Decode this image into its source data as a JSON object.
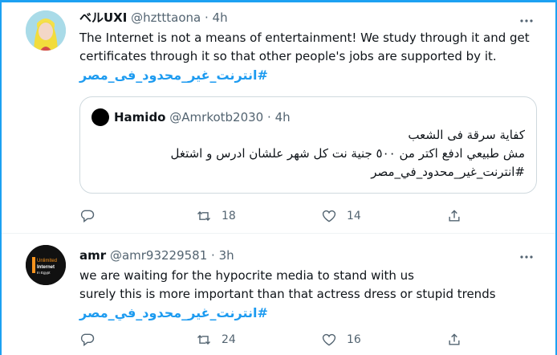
{
  "tweets": [
    {
      "display_name": "ベルUXI",
      "handle": "@hztttaona",
      "sep": "·",
      "time": "4h",
      "text_lines": [
        "The Internet is not a means of entertainment! We study through it and get",
        "certificates through it so that other people's jobs are supported by it."
      ],
      "hashtag": "#انترنت_غير_محدود_فى_مصر",
      "quote": {
        "display_name": "Hamido",
        "handle": "@Amrkotb2030",
        "sep": "·",
        "time": "4h",
        "lines": [
          "كفاية سرقة فى الشعب",
          "مش طبيعي ادفع اكتر من ٥٠٠ جنية نت كل شهر علشان ادرس و اشتغل",
          "#انترنت_غير_محدود_في_مصر"
        ]
      },
      "actions": {
        "reply": "",
        "retweet": "18",
        "like": "14",
        "share": ""
      }
    },
    {
      "display_name": "amr",
      "handle": "@amr93229581",
      "sep": "·",
      "time": "3h",
      "text_lines": [
        "we are waiting for the hypocrite media to stand with us",
        "surely this is more important than that actress dress or stupid trends"
      ],
      "hashtag": "#انترنت_غير_محدود_في_مصر",
      "avatar_text": [
        "Unlimited",
        "Internet",
        "In Egypt"
      ],
      "actions": {
        "reply": "",
        "retweet": "24",
        "like": "16",
        "share": ""
      }
    }
  ],
  "colors": {
    "accent": "#1d9bf0",
    "muted": "#536471",
    "frame": "#1da1f2"
  }
}
